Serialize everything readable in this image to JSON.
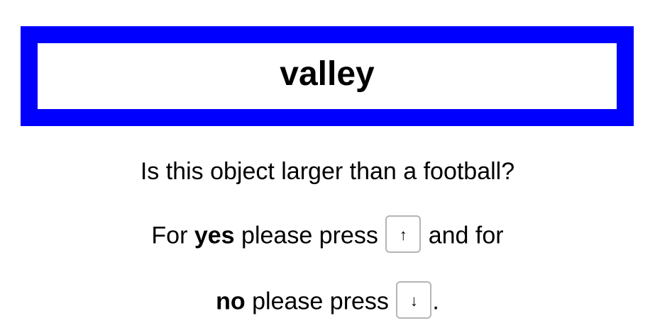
{
  "stimulus": {
    "word": "valley",
    "frame_color": "#0000ff"
  },
  "prompt": {
    "question": "Is this object larger than a football?",
    "line1_prefix": "For ",
    "yes_word": "yes",
    "line1_middle": " please press ",
    "up_key": "↑",
    "line1_suffix": " and for",
    "no_word": "no",
    "line2_middle": " please press ",
    "down_key": "↓",
    "line2_suffix": "."
  }
}
